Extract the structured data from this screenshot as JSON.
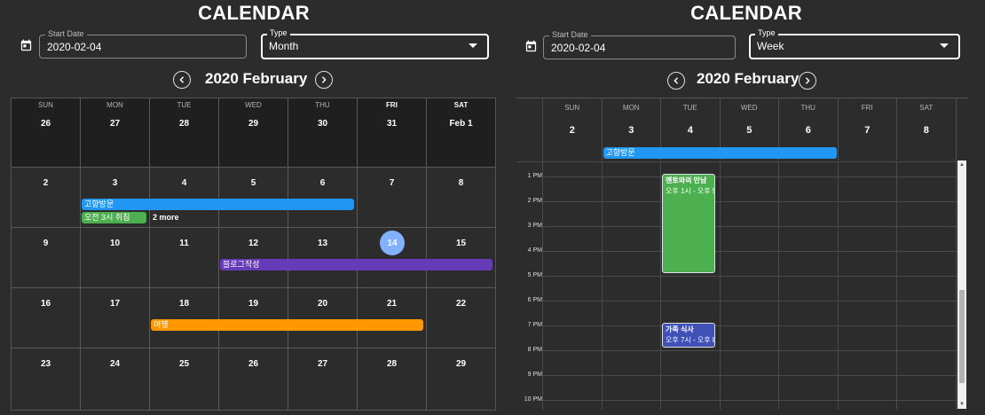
{
  "left": {
    "title": "CALENDAR",
    "start_date": {
      "label": "Start Date",
      "value": "2020-02-04"
    },
    "type": {
      "label": "Type",
      "value": "Month"
    },
    "month_title": "2020 February",
    "weekdays": [
      "SUN",
      "MON",
      "TUE",
      "WED",
      "THU",
      "FRI",
      "SAT"
    ],
    "days": [
      [
        "26",
        "27",
        "28",
        "29",
        "30",
        "31",
        "Feb 1"
      ],
      [
        "2",
        "3",
        "4",
        "5",
        "6",
        "7",
        "8"
      ],
      [
        "9",
        "10",
        "11",
        "12",
        "13",
        "14",
        "15"
      ],
      [
        "16",
        "17",
        "18",
        "19",
        "20",
        "21",
        "22"
      ],
      [
        "23",
        "24",
        "25",
        "26",
        "27",
        "28",
        "29"
      ]
    ],
    "events": {
      "homecoming": {
        "label": "고향방문",
        "color": "#2196f3"
      },
      "job": {
        "label": "오전 3시 취침",
        "color": "#4caf50"
      },
      "more": "2 more",
      "blog": {
        "label": "블로그작성",
        "color": "#673ab7"
      },
      "trip": {
        "label": "여행",
        "color": "#ff9800"
      }
    },
    "today_color": "#82b1ff"
  },
  "right": {
    "title": "CALENDAR",
    "start_date": {
      "label": "Start Date",
      "value": "2020-02-04"
    },
    "type": {
      "label": "Type",
      "value": "Week"
    },
    "month_title": "2020 February",
    "weekdays": [
      "SUN",
      "MON",
      "TUE",
      "WED",
      "THU",
      "FRI",
      "SAT"
    ],
    "day_numbers": [
      "2",
      "3",
      "4",
      "5",
      "6",
      "7",
      "8"
    ],
    "allday_event": {
      "label": "고향방문",
      "color": "#2196f3"
    },
    "times": [
      "1 PM",
      "2 PM",
      "3 PM",
      "4 PM",
      "5 PM",
      "6 PM",
      "7 PM",
      "8 PM",
      "9 PM",
      "10 PM"
    ],
    "events": {
      "mentor": {
        "title": "멘토와의 만남",
        "time": "오후 1시 - 오후 5",
        "color": "#4caf50"
      },
      "family": {
        "title": "가족 식사",
        "time": "오후 7시 - 오후 8",
        "color": "#3f51b5"
      }
    }
  }
}
